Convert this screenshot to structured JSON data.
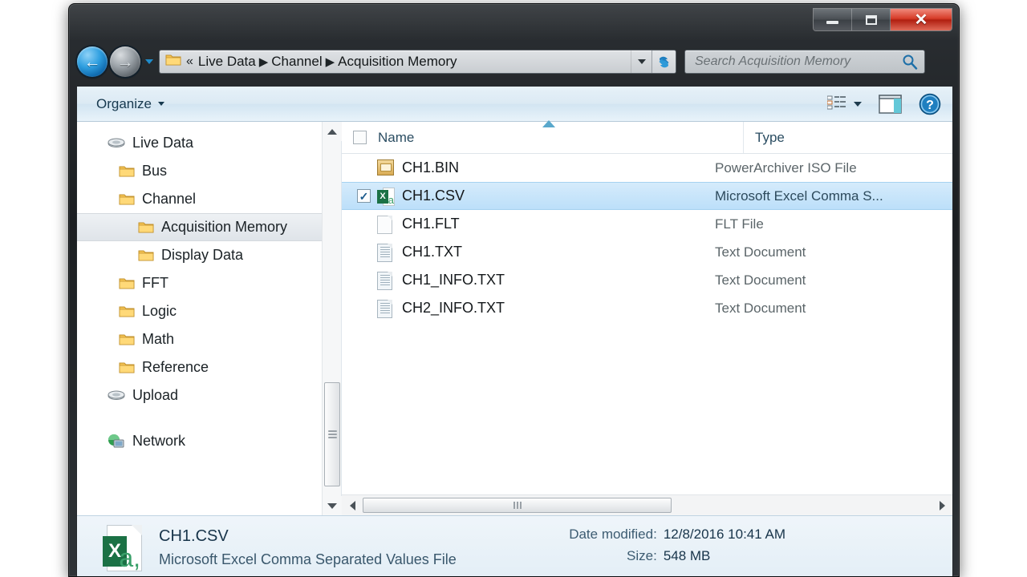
{
  "window": {
    "minimize_label": "Minimize",
    "maximize_label": "Maximize",
    "close_label": "Close",
    "close_glyph": "✕"
  },
  "navigation": {
    "back_label": "Back",
    "back_glyph": "←",
    "forward_label": "Forward",
    "forward_glyph": "→",
    "history_label": "Recent pages"
  },
  "address": {
    "overflow_glyph": "«",
    "separator_glyph": "▶",
    "crumbs": [
      {
        "label": "Live Data"
      },
      {
        "label": "Channel"
      },
      {
        "label": "Acquisition Memory"
      }
    ],
    "refresh_label": "Refresh"
  },
  "search": {
    "placeholder": "Search Acquisition Memory",
    "value": ""
  },
  "toolbar": {
    "organize_label": "Organize",
    "views_label": "Change your view",
    "preview_pane_label": "Show the preview pane",
    "help_label": "Get help"
  },
  "sidebar": {
    "items": [
      {
        "label": "Live Data",
        "icon": "drive-icon",
        "depth": 0,
        "selected": false
      },
      {
        "label": "Bus",
        "icon": "folder-icon",
        "depth": 1,
        "selected": false
      },
      {
        "label": "Channel",
        "icon": "folder-icon",
        "depth": 1,
        "selected": false
      },
      {
        "label": "Acquisition Memory",
        "icon": "folder-icon",
        "depth": 2,
        "selected": true
      },
      {
        "label": "Display Data",
        "icon": "folder-icon",
        "depth": 2,
        "selected": false
      },
      {
        "label": "FFT",
        "icon": "folder-icon",
        "depth": 1,
        "selected": false
      },
      {
        "label": "Logic",
        "icon": "folder-icon",
        "depth": 1,
        "selected": false
      },
      {
        "label": "Math",
        "icon": "folder-icon",
        "depth": 1,
        "selected": false
      },
      {
        "label": "Reference",
        "icon": "folder-icon",
        "depth": 1,
        "selected": false
      },
      {
        "label": "Upload",
        "icon": "drive-icon",
        "depth": 0,
        "selected": false
      },
      {
        "label": "Network",
        "icon": "network-icon",
        "depth": 0,
        "selected": false
      }
    ]
  },
  "filelist": {
    "columns": [
      {
        "label": "Name",
        "sorted": true,
        "sort_direction": "ascending"
      },
      {
        "label": "Type",
        "sorted": false
      }
    ],
    "rows": [
      {
        "name": "CH1.BIN",
        "type": "PowerArchiver ISO File",
        "icon": "bin-file-icon",
        "selected": false,
        "checked": false
      },
      {
        "name": "CH1.CSV",
        "type": "Microsoft Excel Comma S...",
        "icon": "excel-csv-icon",
        "selected": true,
        "checked": true
      },
      {
        "name": "CH1.FLT",
        "type": "FLT File",
        "icon": "blank-file-icon",
        "selected": false,
        "checked": false
      },
      {
        "name": "CH1.TXT",
        "type": "Text Document",
        "icon": "text-file-icon",
        "selected": false,
        "checked": false
      },
      {
        "name": "CH1_INFO.TXT",
        "type": "Text Document",
        "icon": "text-file-icon",
        "selected": false,
        "checked": false
      },
      {
        "name": "CH2_INFO.TXT",
        "type": "Text Document",
        "icon": "text-file-icon",
        "selected": false,
        "checked": false
      }
    ]
  },
  "details": {
    "filename": "CH1.CSV",
    "filetype": "Microsoft Excel Comma Separated Values File",
    "date_modified_label": "Date modified:",
    "date_modified_value": "12/8/2016 10:41 AM",
    "size_label": "Size:",
    "size_value": "548 MB"
  },
  "colors": {
    "selection_blue": "#bcdffa",
    "accent_blue": "#1f8ccc",
    "excel_green": "#1b7145",
    "close_red": "#d63b28"
  }
}
